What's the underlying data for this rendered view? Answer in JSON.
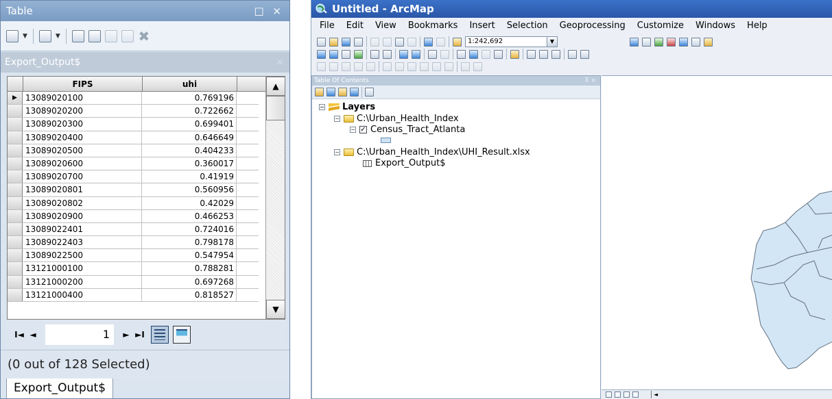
{
  "table_window": {
    "title": "Table",
    "controls": "□ ×",
    "tab_header": "Export_Output$",
    "columns": [
      "FIPS",
      "uhi"
    ],
    "rows": [
      {
        "fips": "13089020100",
        "uhi": "0.769196"
      },
      {
        "fips": "13089020200",
        "uhi": "0.722662"
      },
      {
        "fips": "13089020300",
        "uhi": "0.699401"
      },
      {
        "fips": "13089020400",
        "uhi": "0.646649"
      },
      {
        "fips": "13089020500",
        "uhi": "0.404233"
      },
      {
        "fips": "13089020600",
        "uhi": "0.360017"
      },
      {
        "fips": "13089020700",
        "uhi": "0.41919"
      },
      {
        "fips": "13089020801",
        "uhi": "0.560956"
      },
      {
        "fips": "13089020802",
        "uhi": "0.42029"
      },
      {
        "fips": "13089020900",
        "uhi": "0.466253"
      },
      {
        "fips": "13089022401",
        "uhi": "0.724016"
      },
      {
        "fips": "13089022403",
        "uhi": "0.798178"
      },
      {
        "fips": "13089022500",
        "uhi": "0.547954"
      },
      {
        "fips": "13121000100",
        "uhi": "0.788281"
      },
      {
        "fips": "13121000200",
        "uhi": "0.697268"
      },
      {
        "fips": "13121000400",
        "uhi": "0.818527"
      }
    ],
    "current_row_marker": "▶",
    "nav": {
      "first": "I◄",
      "prev": "◄",
      "page": "1",
      "next": "►",
      "last": "►I"
    },
    "status": "(0 out of 128 Selected)",
    "bottom_tab": "Export_Output$"
  },
  "arcmap": {
    "title": "Untitled - ArcMap",
    "menu": [
      "File",
      "Edit",
      "View",
      "Bookmarks",
      "Insert",
      "Selection",
      "Geoprocessing",
      "Customize",
      "Windows",
      "Help"
    ],
    "scale": "1:242,692",
    "toc": {
      "header": "Table Of Contents",
      "pin": "⊼ ×",
      "layers_label": "Layers",
      "folder1": "C:\\Urban_Health_Index",
      "layer1": "Census_Tract_Atlanta",
      "folder2": "C:\\Urban_Health_Index\\UHI_Result.xlsx",
      "table1": "Export_Output$"
    },
    "map_fill_color": "#d3e6f5",
    "map_stroke_color": "#5e6e80"
  }
}
